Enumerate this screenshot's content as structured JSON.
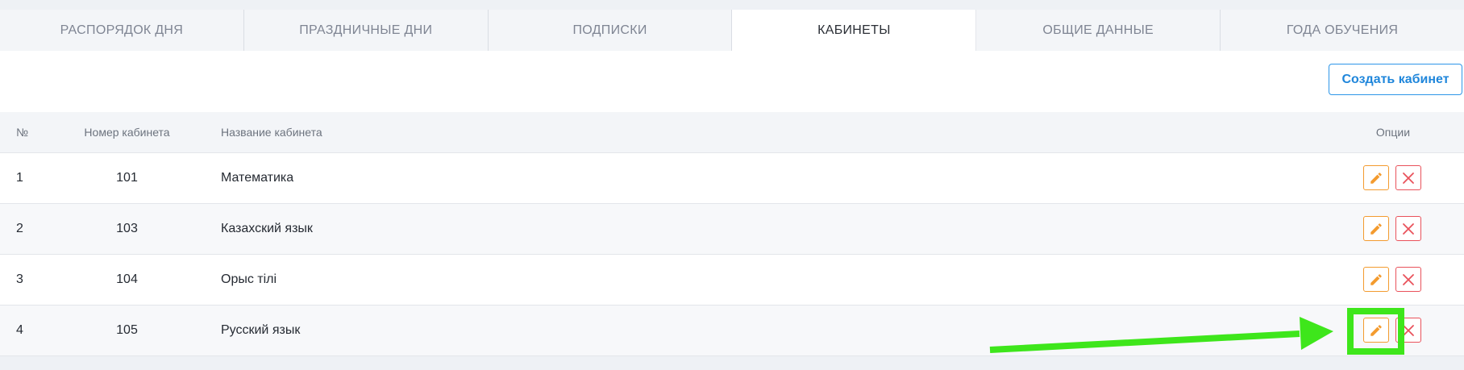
{
  "tabs": [
    {
      "label": "РАСПОРЯДОК ДНЯ",
      "active": false
    },
    {
      "label": "ПРАЗДНИЧНЫЕ ДНИ",
      "active": false
    },
    {
      "label": "ПОДПИСКИ",
      "active": false
    },
    {
      "label": "КАБИНЕТЫ",
      "active": true
    },
    {
      "label": "ОБЩИЕ ДАННЫЕ",
      "active": false
    },
    {
      "label": "ГОДА ОБУЧЕНИЯ",
      "active": false
    }
  ],
  "toolbar": {
    "create_label": "Создать кабинет"
  },
  "table": {
    "headers": {
      "num": "№",
      "room": "Номер кабинета",
      "name": "Название кабинета",
      "options": "Опции"
    },
    "rows": [
      {
        "num": "1",
        "room": "101",
        "name": "Математика"
      },
      {
        "num": "2",
        "room": "103",
        "name": "Казахский язык"
      },
      {
        "num": "3",
        "room": "104",
        "name": "Орыс тілі"
      },
      {
        "num": "4",
        "room": "105",
        "name": "Русский язык"
      }
    ]
  },
  "icons": {
    "edit": "pencil-icon",
    "delete": "close-icon"
  },
  "colors": {
    "accent": "#2d96e8",
    "edit": "#f39b2f",
    "delete": "#e9525b",
    "annotation": "#3ee61b"
  }
}
